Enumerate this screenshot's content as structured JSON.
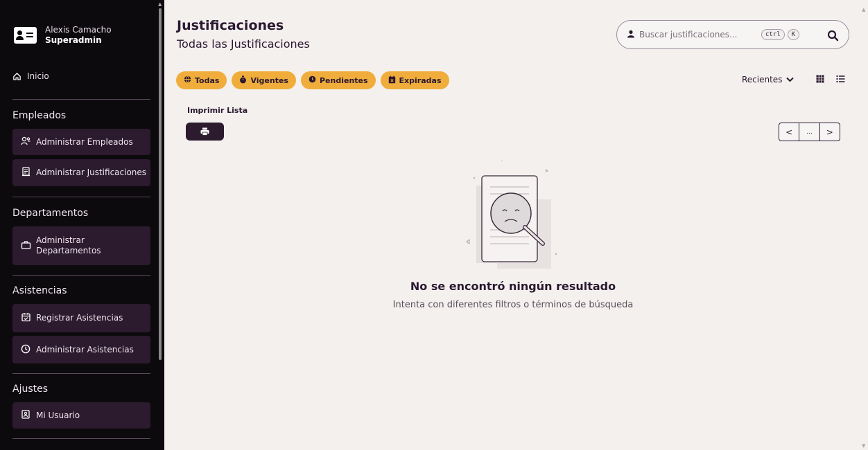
{
  "user": {
    "name": "Alexis Camacho",
    "role": "Superadmin"
  },
  "sidebar": {
    "home": "Inicio",
    "sections": [
      {
        "title": "Empleados",
        "items": [
          "Administrar Empleados",
          "Administrar Justificaciones"
        ]
      },
      {
        "title": "Departamentos",
        "items": [
          "Administrar Departamentos"
        ]
      },
      {
        "title": "Asistencias",
        "items": [
          "Registrar Asistencias",
          "Administrar Asistencias"
        ]
      },
      {
        "title": "Ajustes",
        "items": [
          "Mi Usuario"
        ]
      }
    ]
  },
  "header": {
    "title": "Justificaciones",
    "subtitle": "Todas las Justificaciones"
  },
  "search": {
    "placeholder": "Buscar justificaciones...",
    "kbd_ctrl": "ctrl",
    "kbd_k": "K"
  },
  "filters": [
    "Todas",
    "Vigentes",
    "Pendientes",
    "Expiradas"
  ],
  "sort": {
    "label": "Recientes"
  },
  "print": {
    "label": "Imprimir Lista"
  },
  "pager": {
    "prev": "<",
    "middle": "...",
    "next": ">"
  },
  "empty": {
    "title": "No se encontró ningún resultado",
    "subtitle": "Intenta con diferentes filtros o términos de búsqueda"
  },
  "colors": {
    "sidebar_bg": "#0d0a0d",
    "nav_item_bg": "#2c1a2e",
    "chip": "#f0ad3c",
    "page_bg": "#f3f0ee"
  },
  "icons": {
    "home": "home-icon",
    "employees": "users-icon",
    "justifications": "document-icon",
    "departments": "briefcase-icon",
    "register": "calendar-check-icon",
    "attendance": "clock-icon",
    "user": "id-card-icon",
    "search": "search-icon",
    "print": "printer-icon"
  }
}
